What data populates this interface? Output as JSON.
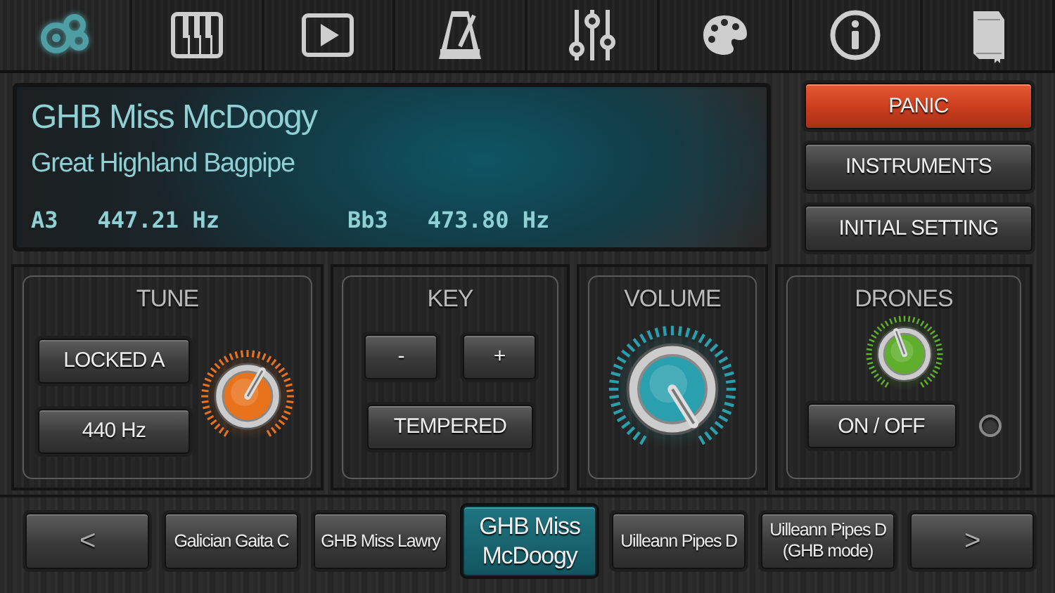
{
  "toolbar": [
    {
      "kind": "gears",
      "selected": true
    },
    {
      "kind": "piano",
      "selected": false
    },
    {
      "kind": "play",
      "selected": false
    },
    {
      "kind": "metronome",
      "selected": false
    },
    {
      "kind": "sliders",
      "selected": false
    },
    {
      "kind": "palette",
      "selected": false
    },
    {
      "kind": "info",
      "selected": false
    },
    {
      "kind": "book",
      "selected": false
    }
  ],
  "display": {
    "title": "GHB Miss McDoogy",
    "subtitle": "Great Highland Bagpipe",
    "readings": [
      {
        "note": "A3",
        "frequency": "447.21 Hz"
      },
      {
        "note": "Bb3",
        "frequency": "473.80 Hz"
      }
    ]
  },
  "actions": [
    {
      "label": "PANIC",
      "kind": "alert"
    },
    {
      "label": "INSTRUMENTS",
      "kind": "normal"
    },
    {
      "label": "INITIAL SETTING",
      "kind": "normal"
    }
  ],
  "panels": [
    {
      "title": "TUNE",
      "kind": "tune",
      "buttons": [
        "LOCKED A",
        "440 Hz"
      ],
      "knob": {
        "color": "#e8731c"
      }
    },
    {
      "title": "KEY",
      "kind": "key",
      "buttons": [
        "-",
        "+",
        "TEMPERED"
      ]
    },
    {
      "title": "VOLUME",
      "kind": "volume",
      "knob": {
        "color": "#2a9fae"
      }
    },
    {
      "title": "DRONES",
      "kind": "drones",
      "buttons": [
        "ON / OFF"
      ],
      "knob": {
        "color": "#5fae2c"
      },
      "led_on": false
    }
  ],
  "presets": {
    "prev": "<",
    "next": ">",
    "items": [
      {
        "label": "Galician Gaita C",
        "selected": false
      },
      {
        "label": "GHB Miss Lawry",
        "selected": false
      },
      {
        "label": "GHB Miss McDoogy",
        "selected": true
      },
      {
        "label": "Uilleann Pipes D",
        "selected": false
      },
      {
        "label": "Uilleann Pipes D (GHB mode)",
        "selected": false
      }
    ]
  }
}
